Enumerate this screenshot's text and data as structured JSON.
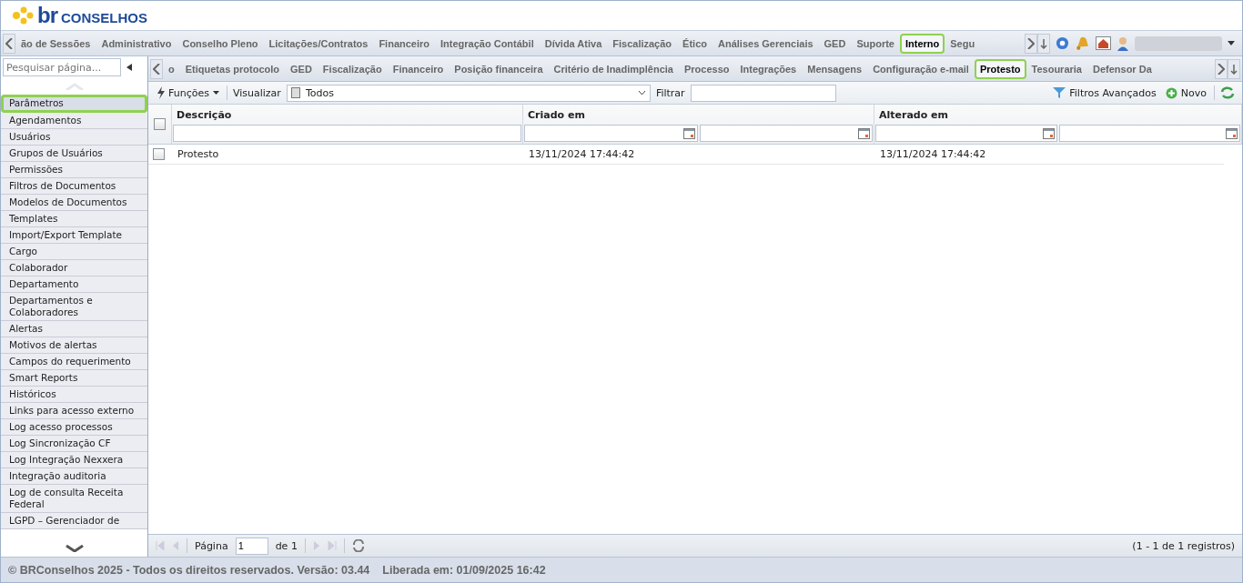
{
  "header": {
    "logo_prefix": "br",
    "logo_text": "CONSELHOS"
  },
  "main_tabs": [
    {
      "label": "ão de Sessões",
      "selected": false
    },
    {
      "label": "Administrativo",
      "selected": false
    },
    {
      "label": "Conselho Pleno",
      "selected": false
    },
    {
      "label": "Licitações/Contratos",
      "selected": false
    },
    {
      "label": "Financeiro",
      "selected": false
    },
    {
      "label": "Integração Contábil",
      "selected": false
    },
    {
      "label": "Dívida Ativa",
      "selected": false
    },
    {
      "label": "Fiscalização",
      "selected": false
    },
    {
      "label": "Ético",
      "selected": false
    },
    {
      "label": "Análises Gerenciais",
      "selected": false
    },
    {
      "label": "GED",
      "selected": false
    },
    {
      "label": "Suporte",
      "selected": false
    },
    {
      "label": "Interno",
      "selected": true
    },
    {
      "label": "Segu",
      "selected": false
    }
  ],
  "sidebar": {
    "search_placeholder": "Pesquisar página...",
    "items": [
      {
        "label": "Parâmetros",
        "selected": true
      },
      {
        "label": "Agendamentos",
        "selected": false
      },
      {
        "label": "Usuários",
        "selected": false
      },
      {
        "label": "Grupos de Usuários",
        "selected": false
      },
      {
        "label": "Permissões",
        "selected": false
      },
      {
        "label": "Filtros de Documentos",
        "selected": false
      },
      {
        "label": "Modelos de Documentos",
        "selected": false
      },
      {
        "label": "Templates",
        "selected": false
      },
      {
        "label": "Import/Export Template",
        "selected": false
      },
      {
        "label": "Cargo",
        "selected": false
      },
      {
        "label": "Colaborador",
        "selected": false
      },
      {
        "label": "Departamento",
        "selected": false
      },
      {
        "label": "Departamentos e Colaboradores",
        "selected": false
      },
      {
        "label": "Alertas",
        "selected": false
      },
      {
        "label": "Motivos de alertas",
        "selected": false
      },
      {
        "label": "Campos do requerimento",
        "selected": false
      },
      {
        "label": "Smart Reports",
        "selected": false
      },
      {
        "label": "Históricos",
        "selected": false
      },
      {
        "label": "Links para acesso externo",
        "selected": false
      },
      {
        "label": "Log acesso processos",
        "selected": false
      },
      {
        "label": "Log Sincronização CF",
        "selected": false
      },
      {
        "label": "Log Integração Nexxera",
        "selected": false
      },
      {
        "label": "Integração auditoria",
        "selected": false
      },
      {
        "label": "Log de consulta Receita Federal",
        "selected": false
      },
      {
        "label": "LGPD – Gerenciador de",
        "selected": false
      }
    ]
  },
  "sub_tabs": [
    {
      "label": "o",
      "selected": false
    },
    {
      "label": "Etiquetas protocolo",
      "selected": false
    },
    {
      "label": "GED",
      "selected": false
    },
    {
      "label": "Fiscalização",
      "selected": false
    },
    {
      "label": "Financeiro",
      "selected": false
    },
    {
      "label": "Posição financeira",
      "selected": false
    },
    {
      "label": "Critério de Inadimplência",
      "selected": false
    },
    {
      "label": "Processo",
      "selected": false
    },
    {
      "label": "Integrações",
      "selected": false
    },
    {
      "label": "Mensagens",
      "selected": false
    },
    {
      "label": "Configuração e-mail",
      "selected": false
    },
    {
      "label": "Protesto",
      "selected": true
    },
    {
      "label": "Tesouraria",
      "selected": false
    },
    {
      "label": "Defensor Da",
      "selected": false
    }
  ],
  "toolbar": {
    "functions": "Funções",
    "view_label": "Visualizar",
    "view_value": "Todos",
    "filter_label": "Filtrar",
    "advanced_filters": "Filtros Avançados",
    "new": "Novo"
  },
  "table": {
    "select_all_checked": false,
    "columns": [
      {
        "label": "Descrição",
        "kind": "text"
      },
      {
        "label": "Criado em",
        "kind": "date"
      },
      {
        "label": "Alterado em",
        "kind": "date"
      }
    ],
    "rows": [
      {
        "checked": false,
        "cells": [
          "Protesto",
          "13/11/2024 17:44:42",
          "13/11/2024 17:44:42"
        ]
      }
    ]
  },
  "pager": {
    "page_label": "Página",
    "page": "1",
    "of": "de 1",
    "summary": "(1 - 1 de 1 registros)"
  },
  "footer": {
    "copyright": "© BRConselhos 2025 - Todos os direitos reservados. Versão: 03.44",
    "released": "Liberada em: 01/09/2025 16:42"
  }
}
